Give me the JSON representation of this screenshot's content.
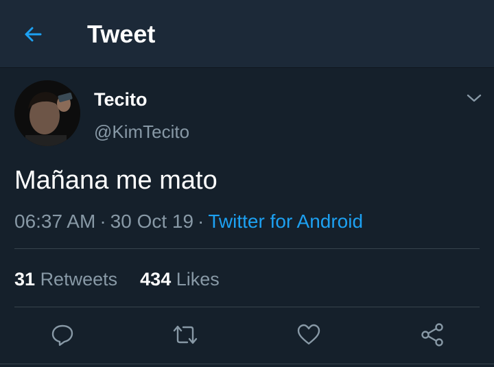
{
  "header": {
    "back_icon": "arrow-left-icon",
    "title": "Tweet"
  },
  "tweet": {
    "author": {
      "display_name": "Tecito",
      "handle": "@KimTecito",
      "avatar_icon": "user-avatar"
    },
    "more_icon": "chevron-down-icon",
    "text": "Mañana me mato",
    "time": "06:37 AM",
    "separator": "·",
    "date": "30 Oct 19",
    "source": "Twitter for Android",
    "stats": {
      "retweets_count": "31",
      "retweets_label": "Retweets",
      "likes_count": "434",
      "likes_label": "Likes"
    },
    "actions": [
      {
        "name": "reply",
        "icon": "reply-icon"
      },
      {
        "name": "retweet",
        "icon": "retweet-icon"
      },
      {
        "name": "like",
        "icon": "heart-icon"
      },
      {
        "name": "share",
        "icon": "share-icon"
      }
    ]
  },
  "colors": {
    "background": "#15202b",
    "header_background": "#1c2938",
    "accent": "#1da1f2",
    "secondary_text": "#8899a6",
    "divider": "#38444d"
  }
}
